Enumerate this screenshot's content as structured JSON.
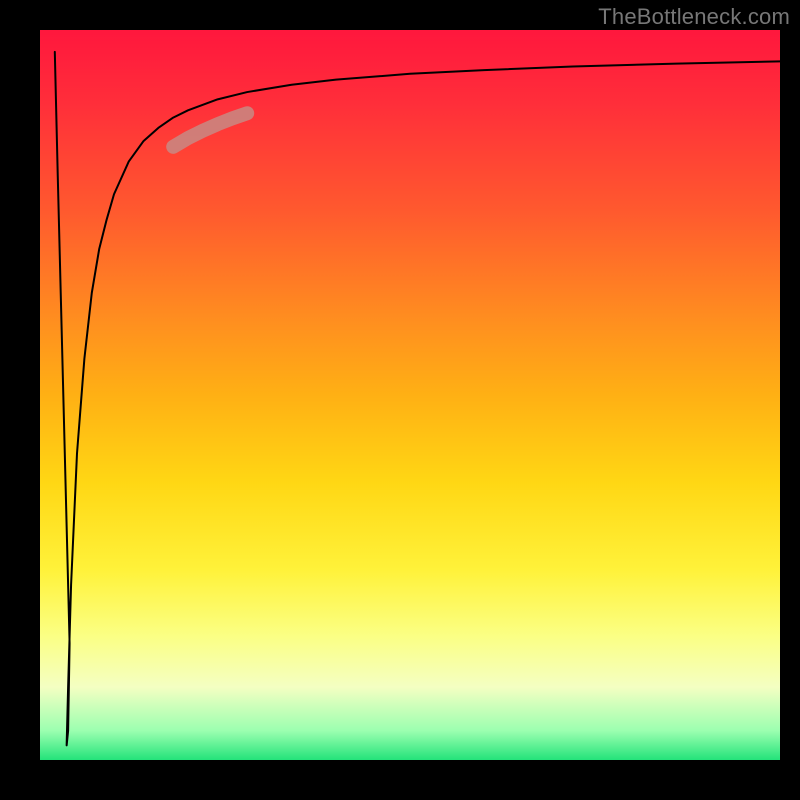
{
  "attribution": "TheBottleneck.com",
  "chart_data": {
    "type": "line",
    "title": "",
    "xlabel": "",
    "ylabel": "",
    "xlim": [
      0,
      100
    ],
    "ylim": [
      0,
      100
    ],
    "grid": false,
    "legend": false,
    "background_gradient": {
      "direction": "vertical",
      "stops": [
        {
          "pos": 0.0,
          "color": "#ff173d"
        },
        {
          "pos": 0.25,
          "color": "#ff5a2e"
        },
        {
          "pos": 0.5,
          "color": "#ffb014"
        },
        {
          "pos": 0.74,
          "color": "#fff23a"
        },
        {
          "pos": 0.9,
          "color": "#f4ffc2"
        },
        {
          "pos": 1.0,
          "color": "#24e37a"
        }
      ]
    },
    "series": [
      {
        "name": "bottleneck-curve",
        "color": "#000000",
        "stroke_width": 2,
        "x": [
          2.0,
          2.4,
          2.8,
          3.2,
          3.6,
          4.0,
          3.8,
          3.6,
          3.8,
          4.2,
          5.0,
          6.0,
          7.0,
          8.0,
          9.0,
          10.0,
          12.0,
          14.0,
          16.0,
          18.0,
          20.0,
          24.0,
          28.0,
          34.0,
          40.0,
          50.0,
          60.0,
          72.0,
          86.0,
          100.0
        ],
        "y": [
          97.0,
          80.0,
          64.0,
          48.0,
          32.0,
          16.0,
          4.0,
          2.0,
          10.0,
          24.0,
          42.0,
          55.0,
          64.0,
          70.0,
          74.0,
          77.5,
          82.0,
          84.8,
          86.6,
          88.0,
          89.0,
          90.5,
          91.5,
          92.5,
          93.2,
          94.0,
          94.5,
          95.0,
          95.4,
          95.7
        ]
      },
      {
        "name": "highlight-segment",
        "color": "#c88a84",
        "stroke_width": 14,
        "stroke_linecap": "round",
        "opacity": 0.85,
        "x": [
          18.0,
          20.0,
          22.0,
          24.0,
          26.0,
          28.0
        ],
        "y": [
          84.0,
          85.2,
          86.2,
          87.1,
          87.9,
          88.6
        ]
      }
    ]
  }
}
